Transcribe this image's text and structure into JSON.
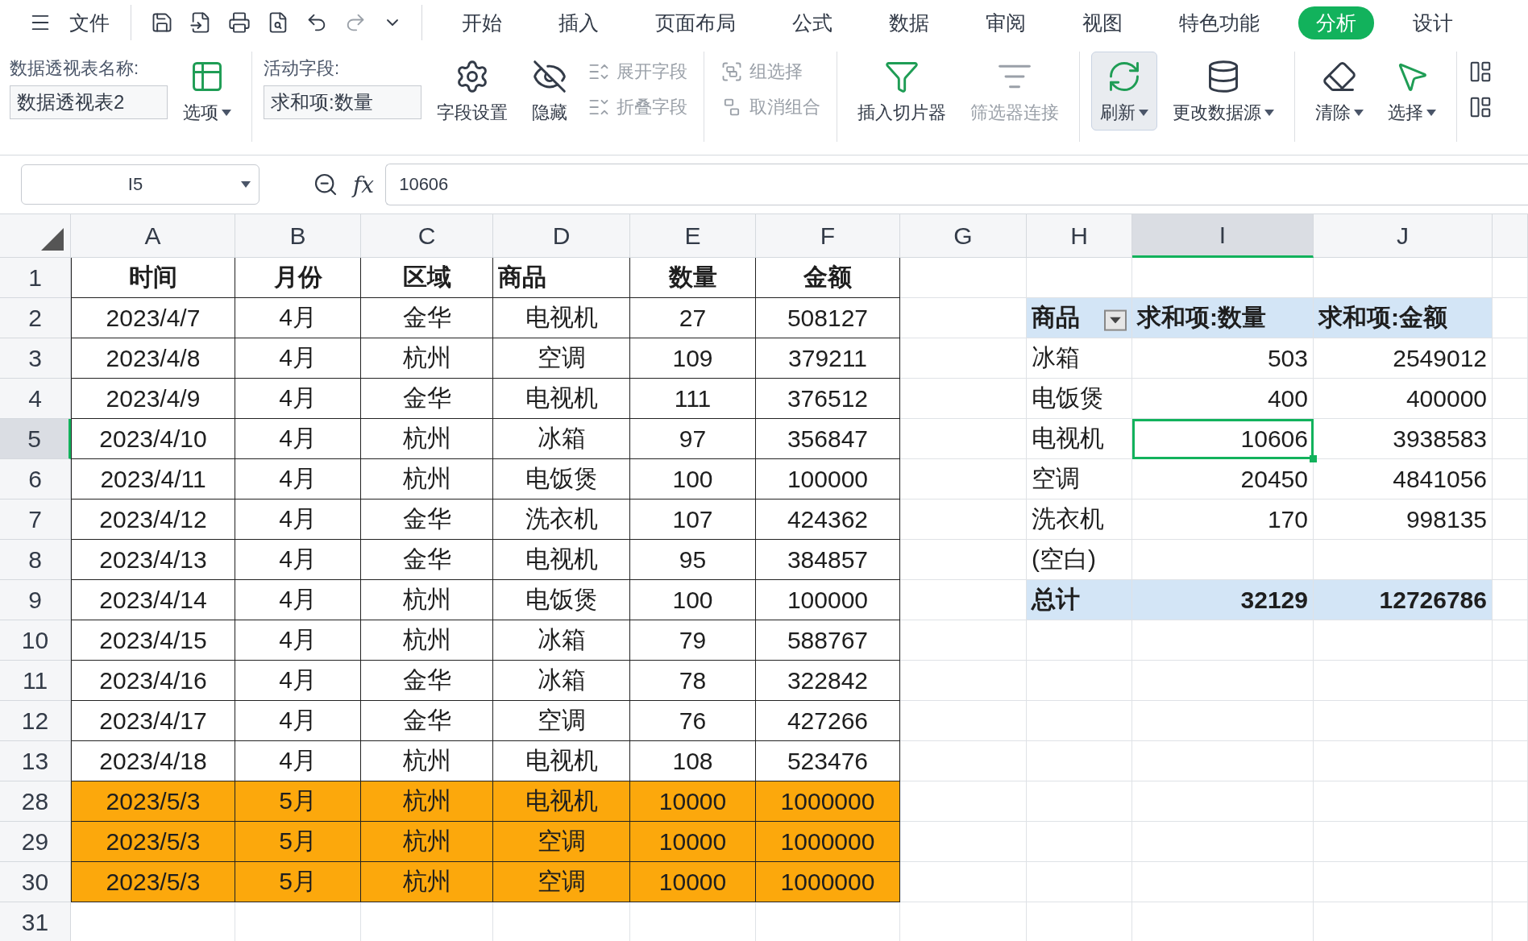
{
  "menu": {
    "file": "文件",
    "tabs": [
      {
        "label": "开始",
        "selected": false
      },
      {
        "label": "插入",
        "selected": false
      },
      {
        "label": "页面布局",
        "selected": false
      },
      {
        "label": "公式",
        "selected": false
      },
      {
        "label": "数据",
        "selected": false
      },
      {
        "label": "审阅",
        "selected": false
      },
      {
        "label": "视图",
        "selected": false
      },
      {
        "label": "特色功能",
        "selected": false
      },
      {
        "label": "分析",
        "selected": true
      },
      {
        "label": "设计",
        "selected": false
      }
    ]
  },
  "ribbon": {
    "groups": [
      {
        "field": {
          "label": "数据透视表名称:",
          "value": "数据透视表2"
        },
        "buttons": [
          {
            "label": "选项",
            "kind": "large",
            "disabled": false,
            "dropdown": true,
            "pressed": false
          }
        ]
      },
      {
        "field": {
          "label": "活动字段:",
          "value": "求和项:数量"
        },
        "buttons": [
          {
            "label": "字段设置",
            "kind": "large",
            "disabled": false,
            "dropdown": false,
            "pressed": false
          },
          {
            "label": "隐藏",
            "kind": "large",
            "disabled": false,
            "dropdown": false,
            "pressed": false
          },
          {
            "label": "展开字段",
            "kind": "small",
            "disabled": true
          },
          {
            "label": "折叠字段",
            "kind": "small",
            "disabled": true
          }
        ]
      },
      {
        "buttons": [
          {
            "label": "组选择",
            "kind": "small",
            "disabled": true
          },
          {
            "label": "取消组合",
            "kind": "small",
            "disabled": true
          }
        ]
      },
      {
        "buttons": [
          {
            "label": "插入切片器",
            "kind": "large",
            "disabled": false,
            "dropdown": false,
            "pressed": false
          },
          {
            "label": "筛选器连接",
            "kind": "large",
            "disabled": true,
            "dropdown": false,
            "pressed": false
          }
        ]
      },
      {
        "buttons": [
          {
            "label": "刷新",
            "kind": "large",
            "disabled": false,
            "dropdown": true,
            "pressed": true
          },
          {
            "label": "更改数据源",
            "kind": "large",
            "disabled": false,
            "dropdown": true,
            "pressed": false
          }
        ]
      },
      {
        "buttons": [
          {
            "label": "清除",
            "kind": "large",
            "disabled": false,
            "dropdown": true,
            "pressed": false
          },
          {
            "label": "选择",
            "kind": "large",
            "disabled": false,
            "dropdown": true,
            "pressed": false
          }
        ]
      }
    ]
  },
  "formula_bar": {
    "name_box": "I5",
    "fx_label": "fx",
    "formula": "10606"
  },
  "sheet": {
    "columns": [
      {
        "label": "A",
        "selected": false
      },
      {
        "label": "B",
        "selected": false
      },
      {
        "label": "C",
        "selected": false
      },
      {
        "label": "D",
        "selected": false
      },
      {
        "label": "E",
        "selected": false
      },
      {
        "label": "F",
        "selected": false
      },
      {
        "label": "G",
        "selected": false
      },
      {
        "label": "H",
        "selected": false
      },
      {
        "label": "I",
        "selected": true
      },
      {
        "label": "J",
        "selected": false
      }
    ],
    "rows": [
      {
        "number": "1",
        "selected": false,
        "kind": "header",
        "highlighted": false,
        "table": [
          "时间",
          "月份",
          "区域",
          "商品",
          "数量",
          "金额"
        ]
      },
      {
        "number": "2",
        "selected": false,
        "kind": "data",
        "highlighted": false,
        "table": [
          "2023/4/7",
          "4月",
          "金华",
          "电视机",
          "27",
          "508127"
        ],
        "pivot": {
          "kind": "header",
          "cells": [
            "商品",
            "求和项:数量",
            "求和项:金额"
          ]
        }
      },
      {
        "number": "3",
        "selected": false,
        "kind": "data",
        "highlighted": false,
        "table": [
          "2023/4/8",
          "4月",
          "杭州",
          "空调",
          "109",
          "379211"
        ],
        "pivot": {
          "kind": "item",
          "cells": [
            "冰箱",
            "503",
            "2549012"
          ]
        }
      },
      {
        "number": "4",
        "selected": false,
        "kind": "data",
        "highlighted": false,
        "table": [
          "2023/4/9",
          "4月",
          "金华",
          "电视机",
          "111",
          "376512"
        ],
        "pivot": {
          "kind": "item",
          "cells": [
            "电饭煲",
            "400",
            "400000"
          ]
        }
      },
      {
        "number": "5",
        "selected": true,
        "kind": "data",
        "highlighted": false,
        "table": [
          "2023/4/10",
          "4月",
          "杭州",
          "冰箱",
          "97",
          "356847"
        ],
        "pivot": {
          "kind": "item",
          "cells": [
            "电视机",
            "10606",
            "3938583"
          ]
        }
      },
      {
        "number": "6",
        "selected": false,
        "kind": "data",
        "highlighted": false,
        "table": [
          "2023/4/11",
          "4月",
          "杭州",
          "电饭煲",
          "100",
          "100000"
        ],
        "pivot": {
          "kind": "item",
          "cells": [
            "空调",
            "20450",
            "4841056"
          ]
        }
      },
      {
        "number": "7",
        "selected": false,
        "kind": "data",
        "highlighted": false,
        "table": [
          "2023/4/12",
          "4月",
          "金华",
          "洗衣机",
          "107",
          "424362"
        ],
        "pivot": {
          "kind": "item",
          "cells": [
            "洗衣机",
            "170",
            "998135"
          ]
        }
      },
      {
        "number": "8",
        "selected": false,
        "kind": "data",
        "highlighted": false,
        "table": [
          "2023/4/13",
          "4月",
          "金华",
          "电视机",
          "95",
          "384857"
        ],
        "pivot": {
          "kind": "item",
          "cells": [
            "(空白)"
          ]
        }
      },
      {
        "number": "9",
        "selected": false,
        "kind": "data",
        "highlighted": false,
        "table": [
          "2023/4/14",
          "4月",
          "杭州",
          "电饭煲",
          "100",
          "100000"
        ],
        "pivot": {
          "kind": "total",
          "cells": [
            "总计",
            "32129",
            "12726786"
          ]
        }
      },
      {
        "number": "10",
        "selected": false,
        "kind": "data",
        "highlighted": false,
        "table": [
          "2023/4/15",
          "4月",
          "杭州",
          "冰箱",
          "79",
          "588767"
        ]
      },
      {
        "number": "11",
        "selected": false,
        "kind": "data",
        "highlighted": false,
        "table": [
          "2023/4/16",
          "4月",
          "金华",
          "冰箱",
          "78",
          "322842"
        ]
      },
      {
        "number": "12",
        "selected": false,
        "kind": "data",
        "highlighted": false,
        "table": [
          "2023/4/17",
          "4月",
          "金华",
          "空调",
          "76",
          "427266"
        ]
      },
      {
        "number": "13",
        "selected": false,
        "kind": "data",
        "highlighted": false,
        "table": [
          "2023/4/18",
          "4月",
          "杭州",
          "电视机",
          "108",
          "523476"
        ]
      },
      {
        "number": "28",
        "selected": false,
        "kind": "data",
        "highlighted": true,
        "table": [
          "2023/5/3",
          "5月",
          "杭州",
          "电视机",
          "10000",
          "1000000"
        ]
      },
      {
        "number": "29",
        "selected": false,
        "kind": "data",
        "highlighted": true,
        "table": [
          "2023/5/3",
          "5月",
          "杭州",
          "空调",
          "10000",
          "1000000"
        ]
      },
      {
        "number": "30",
        "selected": false,
        "kind": "data",
        "highlighted": true,
        "table": [
          "2023/5/3",
          "5月",
          "杭州",
          "空调",
          "10000",
          "1000000"
        ]
      },
      {
        "number": "31",
        "selected": false,
        "kind": "empty"
      }
    ]
  }
}
